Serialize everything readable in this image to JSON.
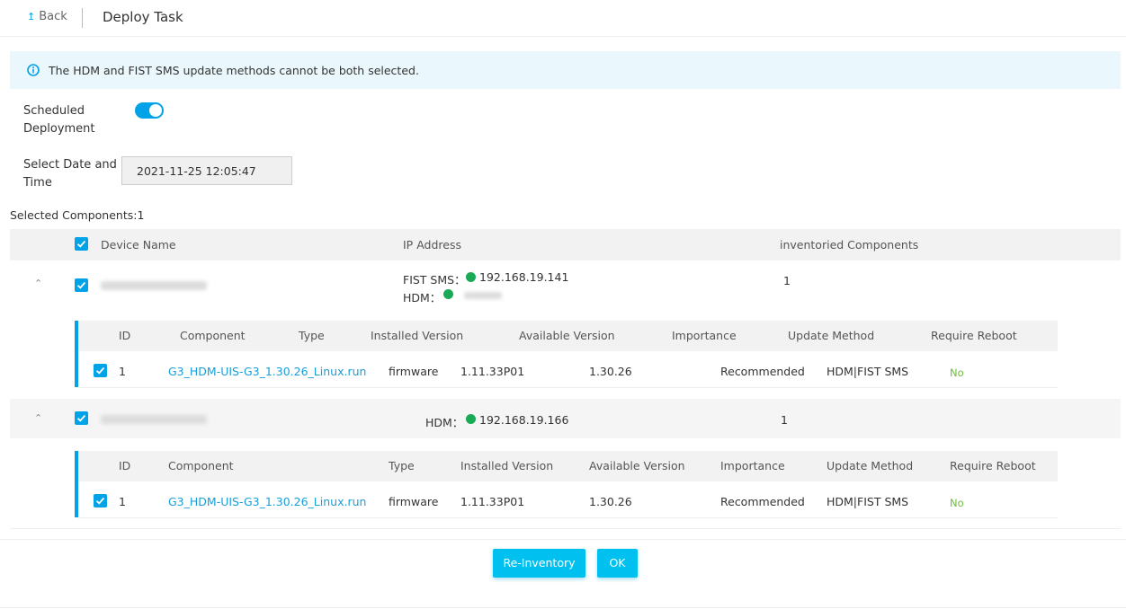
{
  "header": {
    "back_label": "Back",
    "title": "Deploy Task"
  },
  "notice": {
    "text": "The HDM and FIST SMS update methods cannot be both selected.",
    "icon": "info-icon"
  },
  "form": {
    "scheduled_label_line1": "Scheduled",
    "scheduled_label_line2": "Deployment",
    "scheduled_on": true,
    "date_label_line1": "Select Date and",
    "date_label_line2": "Time",
    "date_value": "2021-11-25 12:05:47"
  },
  "selected_components": "Selected Components:1",
  "table": {
    "headers": {
      "device": "Device Name",
      "ip": "IP Address",
      "inv": "inventoried Components"
    },
    "devices": [
      {
        "ip_lines": [
          {
            "label": "FIST SMS：",
            "value": "192.168.19.141"
          },
          {
            "label": "HDM：",
            "value": ""
          }
        ],
        "inventoried": "1",
        "sub_headers": [
          "ID",
          "Component",
          "Type",
          "Installed Version",
          "Available Version",
          "Importance",
          "Update Method",
          "Require Reboot"
        ],
        "components": [
          {
            "id": "1",
            "component": "G3_HDM-UIS-G3_1.30.26_Linux.run",
            "type": "firmware",
            "installed": "1.11.33P01",
            "available": "1.30.26",
            "importance": "Recommended",
            "method": "HDM|FIST SMS",
            "reboot": "No"
          }
        ]
      },
      {
        "ip_lines": [
          {
            "label": "HDM：",
            "value": "192.168.19.166"
          }
        ],
        "inventoried": "1",
        "sub_headers": [
          "ID",
          "Component",
          "Type",
          "Installed Version",
          "Available Version",
          "Importance",
          "Update Method",
          "Require Reboot"
        ],
        "components": [
          {
            "id": "1",
            "component": "G3_HDM-UIS-G3_1.30.26_Linux.run",
            "type": "firmware",
            "installed": "1.11.33P01",
            "available": "1.30.26",
            "importance": "Recommended",
            "method": "HDM|FIST SMS",
            "reboot": "No"
          }
        ]
      }
    ]
  },
  "footer": {
    "reinventory_label": "Re-Inventory",
    "ok_label": "OK"
  },
  "colors": {
    "accent": "#00a2e8",
    "button": "#00c0f0",
    "online": "#1aaa55",
    "no": "#6fbb3f"
  }
}
